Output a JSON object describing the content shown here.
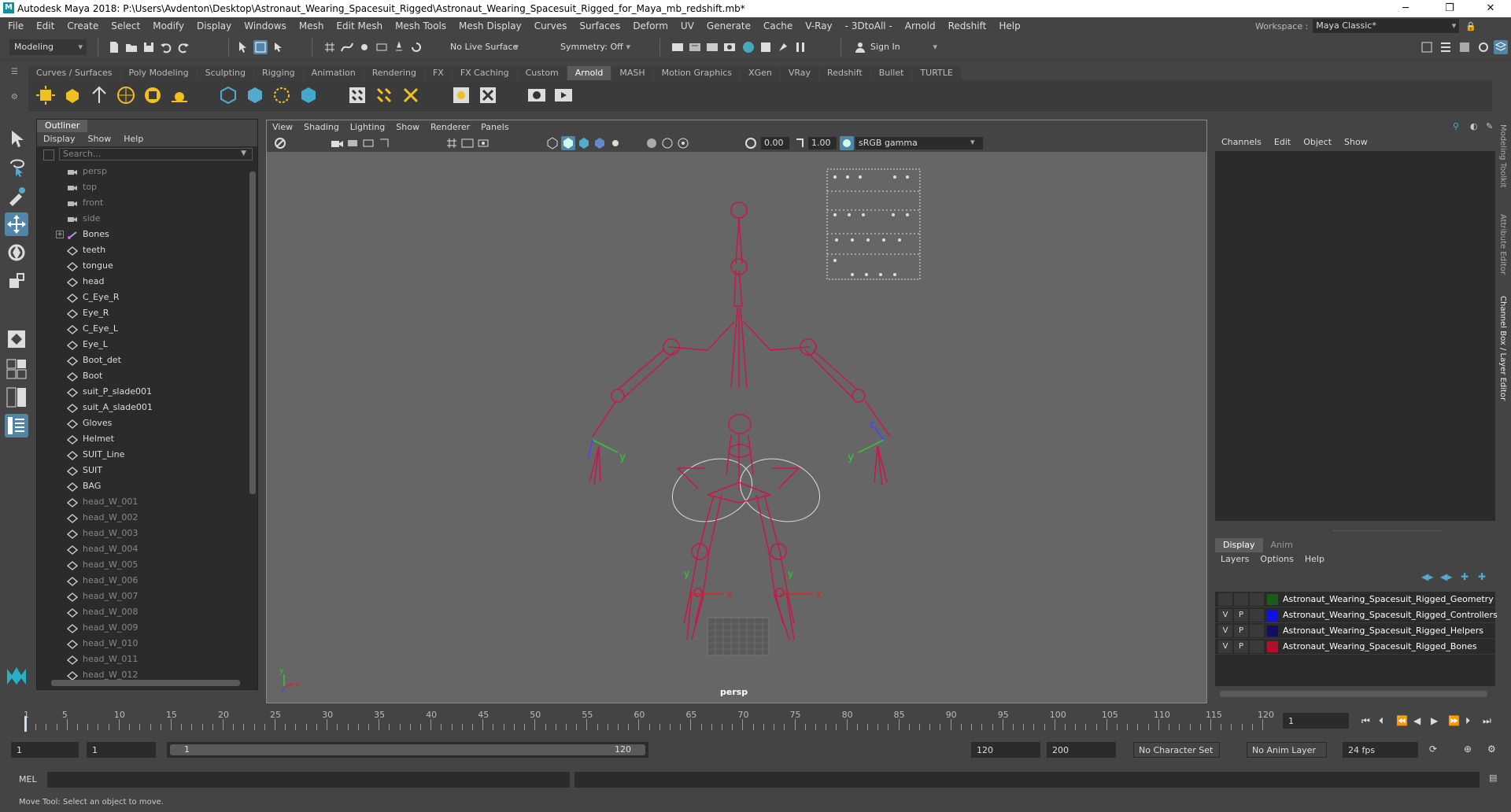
{
  "window": {
    "title": "Autodesk Maya 2018: P:\\Users\\Avdenton\\Desktop\\Astronaut_Wearing_Spacesuit_Rigged\\Astronaut_Wearing_Spacesuit_Rigged_for_Maya_mb_redshift.mb*",
    "logo_text": "M"
  },
  "menubar": {
    "items": [
      "File",
      "Edit",
      "Create",
      "Select",
      "Modify",
      "Display",
      "Windows",
      "Mesh",
      "Edit Mesh",
      "Mesh Tools",
      "Mesh Display",
      "Curves",
      "Surfaces",
      "Deform",
      "UV",
      "Generate",
      "Cache",
      "V-Ray",
      "- 3DtoAll -",
      "Arnold",
      "Redshift",
      "Help"
    ],
    "workspace_label": "Workspace :",
    "workspace_value": "Maya Classic*"
  },
  "statusline": {
    "menuset": "Modeling",
    "live_surface": "No Live Surface",
    "symmetry": "Symmetry: Off",
    "sign_in": "Sign In"
  },
  "shelf": {
    "tabs": [
      "Curves / Surfaces",
      "Poly Modeling",
      "Sculpting",
      "Rigging",
      "Animation",
      "Rendering",
      "FX",
      "FX Caching",
      "Custom",
      "Arnold",
      "MASH",
      "Motion Graphics",
      "XGen",
      "VRay",
      "Redshift",
      "Bullet",
      "TURTLE"
    ],
    "active_tab": "Arnold"
  },
  "outliner": {
    "tab": "Outliner",
    "menu": [
      "Display",
      "Show",
      "Help"
    ],
    "search_placeholder": "Search...",
    "items": [
      {
        "label": "persp",
        "type": "camera",
        "dim": true
      },
      {
        "label": "top",
        "type": "camera",
        "dim": true
      },
      {
        "label": "front",
        "type": "camera",
        "dim": true
      },
      {
        "label": "side",
        "type": "camera",
        "dim": true
      },
      {
        "label": "Bones",
        "type": "joint",
        "dim": false,
        "expandable": true
      },
      {
        "label": "teeth",
        "type": "mesh",
        "dim": false
      },
      {
        "label": "tongue",
        "type": "mesh",
        "dim": false
      },
      {
        "label": "head",
        "type": "mesh",
        "dim": false
      },
      {
        "label": "C_Eye_R",
        "type": "mesh",
        "dim": false
      },
      {
        "label": "Eye_R",
        "type": "mesh",
        "dim": false
      },
      {
        "label": "C_Eye_L",
        "type": "mesh",
        "dim": false
      },
      {
        "label": "Eye_L",
        "type": "mesh",
        "dim": false
      },
      {
        "label": "Boot_det",
        "type": "mesh",
        "dim": false
      },
      {
        "label": "Boot",
        "type": "mesh",
        "dim": false
      },
      {
        "label": "suit_P_slade001",
        "type": "mesh",
        "dim": false
      },
      {
        "label": "suit_A_slade001",
        "type": "mesh",
        "dim": false
      },
      {
        "label": "Gloves",
        "type": "mesh",
        "dim": false
      },
      {
        "label": "Helmet",
        "type": "mesh",
        "dim": false
      },
      {
        "label": "SUIT_Line",
        "type": "mesh",
        "dim": false
      },
      {
        "label": "SUIT",
        "type": "mesh",
        "dim": false
      },
      {
        "label": "BAG",
        "type": "mesh",
        "dim": false
      },
      {
        "label": "head_W_001",
        "type": "mesh",
        "dim": true
      },
      {
        "label": "head_W_002",
        "type": "mesh",
        "dim": true
      },
      {
        "label": "head_W_003",
        "type": "mesh",
        "dim": true
      },
      {
        "label": "head_W_004",
        "type": "mesh",
        "dim": true
      },
      {
        "label": "head_W_005",
        "type": "mesh",
        "dim": true
      },
      {
        "label": "head_W_006",
        "type": "mesh",
        "dim": true
      },
      {
        "label": "head_W_007",
        "type": "mesh",
        "dim": true
      },
      {
        "label": "head_W_008",
        "type": "mesh",
        "dim": true
      },
      {
        "label": "head_W_009",
        "type": "mesh",
        "dim": true
      },
      {
        "label": "head_W_010",
        "type": "mesh",
        "dim": true
      },
      {
        "label": "head_W_011",
        "type": "mesh",
        "dim": true
      },
      {
        "label": "head_W_012",
        "type": "mesh",
        "dim": true
      }
    ]
  },
  "viewport": {
    "menu": [
      "View",
      "Shading",
      "Lighting",
      "Show",
      "Renderer",
      "Panels"
    ],
    "exposure": "0.00",
    "gamma": "1.00",
    "color_space": "sRGB gamma",
    "camera": "persp",
    "axis_labels": {
      "x": "x",
      "y": "y",
      "z": "z"
    },
    "rig_color": "#c8174a"
  },
  "channelbox": {
    "menu": [
      "Channels",
      "Edit",
      "Object",
      "Show"
    ]
  },
  "layer_editor": {
    "tabs": [
      "Display",
      "Anim"
    ],
    "active_tab": "Display",
    "menu": [
      "Layers",
      "Options",
      "Help"
    ],
    "layers": [
      {
        "v": "",
        "p": "",
        "color": "#1a5c1a",
        "name": "Astronaut_Wearing_Spacesuit_Rigged_Geometry"
      },
      {
        "v": "V",
        "p": "P",
        "color": "#1010e0",
        "name": "Astronaut_Wearing_Spacesuit_Rigged_Controllers"
      },
      {
        "v": "V",
        "p": "P",
        "color": "#101060",
        "name": "Astronaut_Wearing_Spacesuit_Rigged_Helpers"
      },
      {
        "v": "V",
        "p": "P",
        "color": "#b0102a",
        "name": "Astronaut_Wearing_Spacesuit_Rigged_Bones"
      }
    ]
  },
  "side_tabs": [
    "Modeling Toolkit",
    "Attribute Editor",
    "Channel Box / Layer Editor"
  ],
  "timeline": {
    "start": 1,
    "end": 120,
    "labels": [
      "5",
      "10",
      "15",
      "20",
      "25",
      "30",
      "35",
      "40",
      "45",
      "50",
      "55",
      "60",
      "65",
      "70",
      "75",
      "80",
      "85",
      "90",
      "95",
      "100",
      "105",
      "110",
      "115",
      "120"
    ],
    "first_label": "1",
    "current_frame": "1"
  },
  "range": {
    "start_field": "1",
    "playback_start": "1",
    "slider_start": "1",
    "slider_end": "120",
    "playback_end": "120",
    "anim_end": "200",
    "character_set": "No Character Set",
    "anim_layer": "No Anim Layer",
    "fps": "24 fps"
  },
  "commandline": {
    "label": "MEL"
  },
  "helpline": {
    "text": "Move Tool: Select an object to move."
  }
}
